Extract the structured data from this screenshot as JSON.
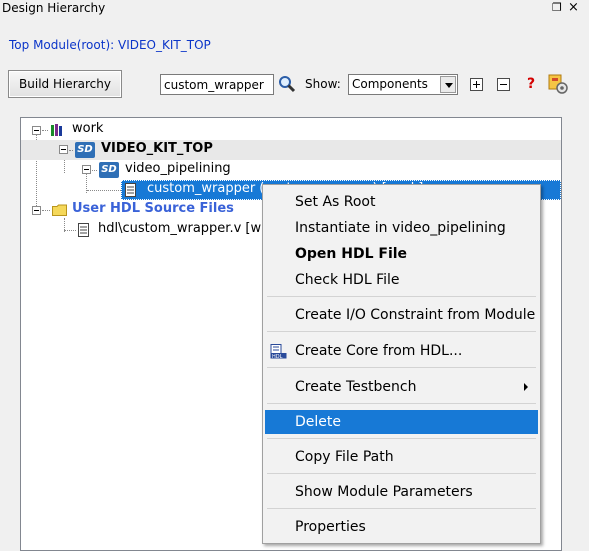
{
  "window": {
    "title": "Design Hierarchy",
    "float_icon": "❐",
    "close_icon": "×"
  },
  "top_module_label": "Top Module(root): VIDEO_KIT_TOP",
  "toolbar": {
    "build_label": "Build Hierarchy",
    "search_value": "custom_wrapper",
    "show_label": "Show:",
    "show_value": "Components",
    "help": "?"
  },
  "tree": {
    "work": "work",
    "top": "VIDEO_KIT_TOP",
    "sd_badge": "SD",
    "pipelining": "video_pipelining",
    "selected": "custom_wrapper (custom_wrapper) [work]",
    "user_hdl": "User HDL Source Files",
    "hdl_file": "hdl\\custom_wrapper.v [w"
  },
  "context_menu": {
    "set_as_root": "Set As Root",
    "instantiate": "Instantiate in video_pipelining",
    "open_hdl": "Open HDL File",
    "check_hdl": "Check HDL File",
    "create_io": "Create I/O Constraint from Module",
    "create_core": "Create Core from HDL...",
    "create_testbench": "Create Testbench",
    "delete": "Delete",
    "copy_path": "Copy File Path",
    "show_params": "Show Module Parameters",
    "properties": "Properties"
  },
  "colors": {
    "link_blue": "#0b35c9",
    "selection": "#1779d6",
    "sd_blue": "#2f6fb6"
  }
}
